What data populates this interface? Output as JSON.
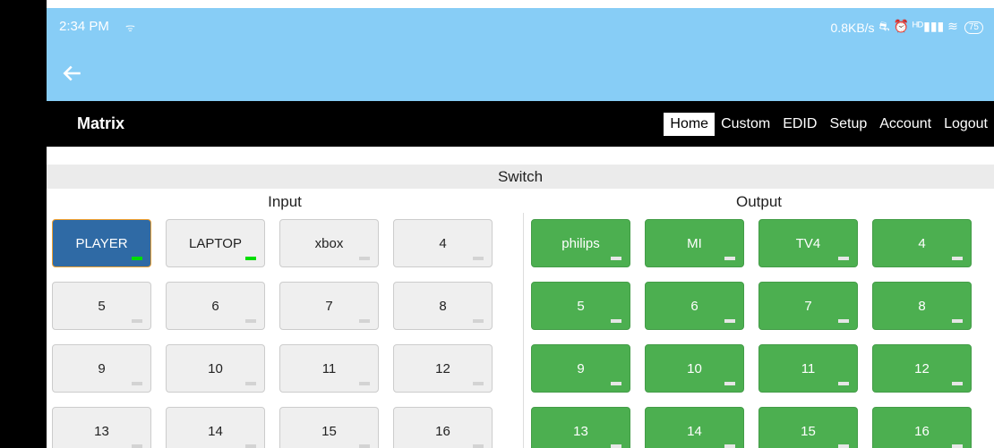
{
  "status_bar": {
    "time": "2:34 PM",
    "signal_glyph": "ᯤ",
    "speed": "0.8KB/s",
    "icons": "⛐ ⏰ ᴴᴰ▮▮▮ ≋",
    "battery": "75"
  },
  "app_bar": {
    "back_icon": "arrow-left-icon"
  },
  "navbar": {
    "brand": "Matrix",
    "links": [
      "Home",
      "Custom",
      "EDID",
      "Setup",
      "Account",
      "Logout"
    ],
    "active": "Home"
  },
  "page": {
    "switch_title": "Switch",
    "input_label": "Input",
    "output_label": "Output"
  },
  "inputs": [
    {
      "label": "PLAYER",
      "indicator": "on",
      "selected": true
    },
    {
      "label": "LAPTOP",
      "indicator": "on",
      "selected": false
    },
    {
      "label": "xbox",
      "indicator": "off",
      "selected": false
    },
    {
      "label": "4",
      "indicator": "off",
      "selected": false
    },
    {
      "label": "5",
      "indicator": "off",
      "selected": false
    },
    {
      "label": "6",
      "indicator": "off",
      "selected": false
    },
    {
      "label": "7",
      "indicator": "off",
      "selected": false
    },
    {
      "label": "8",
      "indicator": "off",
      "selected": false
    },
    {
      "label": "9",
      "indicator": "off",
      "selected": false
    },
    {
      "label": "10",
      "indicator": "off",
      "selected": false
    },
    {
      "label": "11",
      "indicator": "off",
      "selected": false
    },
    {
      "label": "12",
      "indicator": "off",
      "selected": false
    },
    {
      "label": "13",
      "indicator": "off",
      "selected": false
    },
    {
      "label": "14",
      "indicator": "off",
      "selected": false
    },
    {
      "label": "15",
      "indicator": "off",
      "selected": false
    },
    {
      "label": "16",
      "indicator": "off",
      "selected": false
    }
  ],
  "outputs": [
    {
      "label": "philips",
      "indicator": "on"
    },
    {
      "label": "MI",
      "indicator": "off"
    },
    {
      "label": "TV4",
      "indicator": "off"
    },
    {
      "label": "4",
      "indicator": "off"
    },
    {
      "label": "5",
      "indicator": "off"
    },
    {
      "label": "6",
      "indicator": "off"
    },
    {
      "label": "7",
      "indicator": "off"
    },
    {
      "label": "8",
      "indicator": "off"
    },
    {
      "label": "9",
      "indicator": "off"
    },
    {
      "label": "10",
      "indicator": "off"
    },
    {
      "label": "11",
      "indicator": "off"
    },
    {
      "label": "12",
      "indicator": "off"
    },
    {
      "label": "13",
      "indicator": "off"
    },
    {
      "label": "14",
      "indicator": "off"
    },
    {
      "label": "15",
      "indicator": "off"
    },
    {
      "label": "16",
      "indicator": "off"
    }
  ],
  "colors": {
    "app_bar": "#87cdf6",
    "navbar": "#000000",
    "input_selected": "#2f6aa5",
    "input_default": "#efefef",
    "output": "#4caf50",
    "indicator_on": "#00dd00",
    "selected_border": "#f0a030"
  }
}
